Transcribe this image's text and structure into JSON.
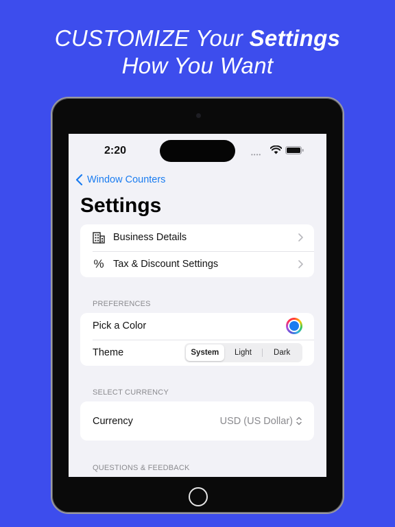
{
  "headline": {
    "line1_normal": "CUSTOMIZE Your ",
    "line1_bold": "Settings",
    "line2": "How You Want"
  },
  "status_bar": {
    "time": "2:20",
    "signal_dots": "••••"
  },
  "nav": {
    "back_label": "Window Counters",
    "title": "Settings"
  },
  "general": {
    "items": [
      {
        "label": "Business Details",
        "icon": "building-icon"
      },
      {
        "label": "Tax & Discount Settings",
        "icon": "percent-icon",
        "glyph": "%"
      }
    ]
  },
  "preferences": {
    "header": "PREFERENCES",
    "pick_color_label": "Pick a Color",
    "selected_color": "#1a7cf0",
    "theme_label": "Theme",
    "theme_options": [
      "System",
      "Light",
      "Dark"
    ],
    "theme_selected": "System"
  },
  "currency_section": {
    "header": "SELECT CURRENCY",
    "label": "Currency",
    "value": "USD (US Dollar)"
  },
  "feedback_section": {
    "header": "QUESTIONS & FEEDBACK"
  },
  "colors": {
    "background": "#3d4ded",
    "accent": "#1a7cf0",
    "screen_bg": "#f2f2f7"
  }
}
